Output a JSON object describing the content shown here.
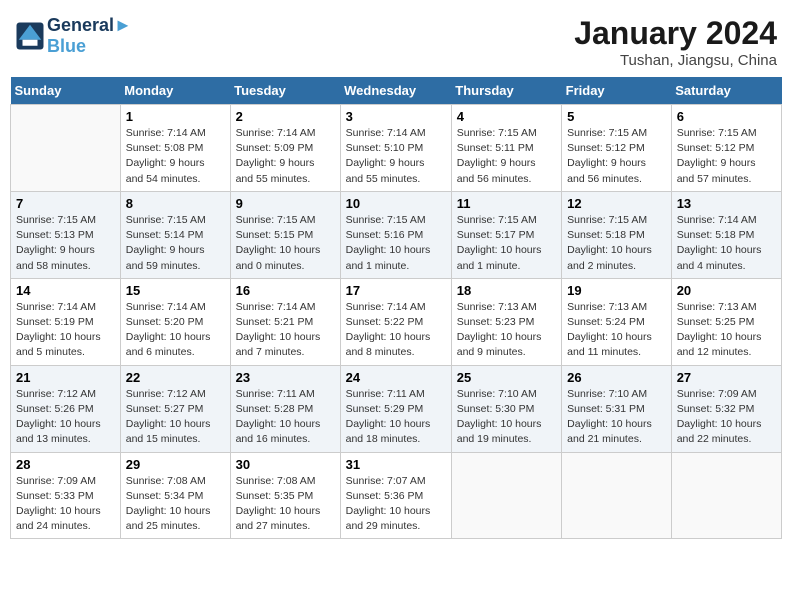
{
  "header": {
    "logo_line1": "General",
    "logo_line2": "Blue",
    "month_year": "January 2024",
    "location": "Tushan, Jiangsu, China"
  },
  "columns": [
    "Sunday",
    "Monday",
    "Tuesday",
    "Wednesday",
    "Thursday",
    "Friday",
    "Saturday"
  ],
  "weeks": [
    [
      {
        "num": "",
        "info": ""
      },
      {
        "num": "1",
        "info": "Sunrise: 7:14 AM\nSunset: 5:08 PM\nDaylight: 9 hours\nand 54 minutes."
      },
      {
        "num": "2",
        "info": "Sunrise: 7:14 AM\nSunset: 5:09 PM\nDaylight: 9 hours\nand 55 minutes."
      },
      {
        "num": "3",
        "info": "Sunrise: 7:14 AM\nSunset: 5:10 PM\nDaylight: 9 hours\nand 55 minutes."
      },
      {
        "num": "4",
        "info": "Sunrise: 7:15 AM\nSunset: 5:11 PM\nDaylight: 9 hours\nand 56 minutes."
      },
      {
        "num": "5",
        "info": "Sunrise: 7:15 AM\nSunset: 5:12 PM\nDaylight: 9 hours\nand 56 minutes."
      },
      {
        "num": "6",
        "info": "Sunrise: 7:15 AM\nSunset: 5:12 PM\nDaylight: 9 hours\nand 57 minutes."
      }
    ],
    [
      {
        "num": "7",
        "info": "Sunrise: 7:15 AM\nSunset: 5:13 PM\nDaylight: 9 hours\nand 58 minutes."
      },
      {
        "num": "8",
        "info": "Sunrise: 7:15 AM\nSunset: 5:14 PM\nDaylight: 9 hours\nand 59 minutes."
      },
      {
        "num": "9",
        "info": "Sunrise: 7:15 AM\nSunset: 5:15 PM\nDaylight: 10 hours\nand 0 minutes."
      },
      {
        "num": "10",
        "info": "Sunrise: 7:15 AM\nSunset: 5:16 PM\nDaylight: 10 hours\nand 1 minute."
      },
      {
        "num": "11",
        "info": "Sunrise: 7:15 AM\nSunset: 5:17 PM\nDaylight: 10 hours\nand 1 minute."
      },
      {
        "num": "12",
        "info": "Sunrise: 7:15 AM\nSunset: 5:18 PM\nDaylight: 10 hours\nand 2 minutes."
      },
      {
        "num": "13",
        "info": "Sunrise: 7:14 AM\nSunset: 5:18 PM\nDaylight: 10 hours\nand 4 minutes."
      }
    ],
    [
      {
        "num": "14",
        "info": "Sunrise: 7:14 AM\nSunset: 5:19 PM\nDaylight: 10 hours\nand 5 minutes."
      },
      {
        "num": "15",
        "info": "Sunrise: 7:14 AM\nSunset: 5:20 PM\nDaylight: 10 hours\nand 6 minutes."
      },
      {
        "num": "16",
        "info": "Sunrise: 7:14 AM\nSunset: 5:21 PM\nDaylight: 10 hours\nand 7 minutes."
      },
      {
        "num": "17",
        "info": "Sunrise: 7:14 AM\nSunset: 5:22 PM\nDaylight: 10 hours\nand 8 minutes."
      },
      {
        "num": "18",
        "info": "Sunrise: 7:13 AM\nSunset: 5:23 PM\nDaylight: 10 hours\nand 9 minutes."
      },
      {
        "num": "19",
        "info": "Sunrise: 7:13 AM\nSunset: 5:24 PM\nDaylight: 10 hours\nand 11 minutes."
      },
      {
        "num": "20",
        "info": "Sunrise: 7:13 AM\nSunset: 5:25 PM\nDaylight: 10 hours\nand 12 minutes."
      }
    ],
    [
      {
        "num": "21",
        "info": "Sunrise: 7:12 AM\nSunset: 5:26 PM\nDaylight: 10 hours\nand 13 minutes."
      },
      {
        "num": "22",
        "info": "Sunrise: 7:12 AM\nSunset: 5:27 PM\nDaylight: 10 hours\nand 15 minutes."
      },
      {
        "num": "23",
        "info": "Sunrise: 7:11 AM\nSunset: 5:28 PM\nDaylight: 10 hours\nand 16 minutes."
      },
      {
        "num": "24",
        "info": "Sunrise: 7:11 AM\nSunset: 5:29 PM\nDaylight: 10 hours\nand 18 minutes."
      },
      {
        "num": "25",
        "info": "Sunrise: 7:10 AM\nSunset: 5:30 PM\nDaylight: 10 hours\nand 19 minutes."
      },
      {
        "num": "26",
        "info": "Sunrise: 7:10 AM\nSunset: 5:31 PM\nDaylight: 10 hours\nand 21 minutes."
      },
      {
        "num": "27",
        "info": "Sunrise: 7:09 AM\nSunset: 5:32 PM\nDaylight: 10 hours\nand 22 minutes."
      }
    ],
    [
      {
        "num": "28",
        "info": "Sunrise: 7:09 AM\nSunset: 5:33 PM\nDaylight: 10 hours\nand 24 minutes."
      },
      {
        "num": "29",
        "info": "Sunrise: 7:08 AM\nSunset: 5:34 PM\nDaylight: 10 hours\nand 25 minutes."
      },
      {
        "num": "30",
        "info": "Sunrise: 7:08 AM\nSunset: 5:35 PM\nDaylight: 10 hours\nand 27 minutes."
      },
      {
        "num": "31",
        "info": "Sunrise: 7:07 AM\nSunset: 5:36 PM\nDaylight: 10 hours\nand 29 minutes."
      },
      {
        "num": "",
        "info": ""
      },
      {
        "num": "",
        "info": ""
      },
      {
        "num": "",
        "info": ""
      }
    ]
  ]
}
